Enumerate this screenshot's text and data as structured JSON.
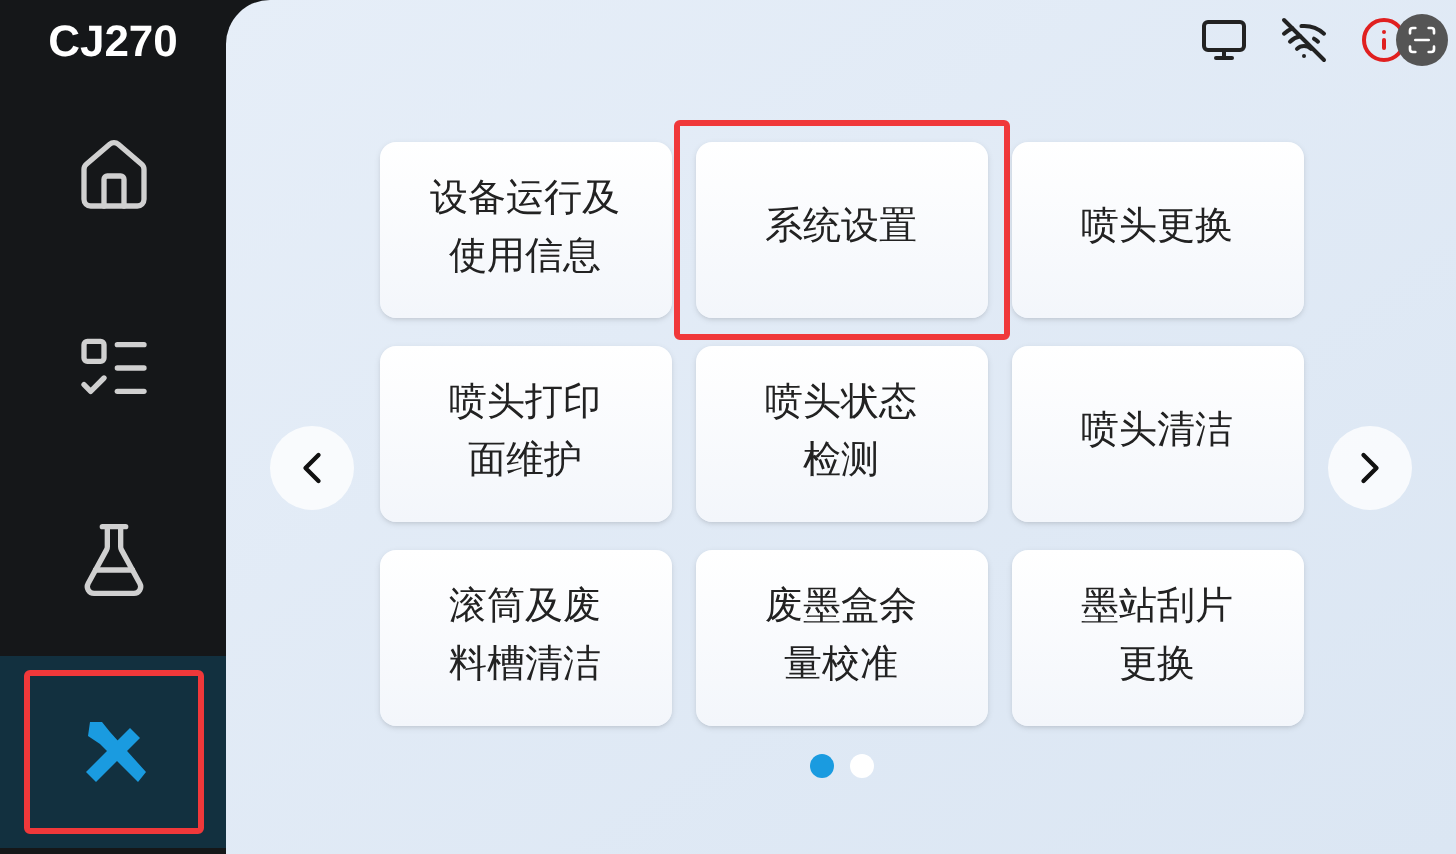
{
  "brand": "CJ270",
  "nav": [
    {
      "kind": "home",
      "selected": false,
      "highlighted": false
    },
    {
      "kind": "list",
      "selected": false,
      "highlighted": false
    },
    {
      "kind": "flask",
      "selected": false,
      "highlighted": false
    },
    {
      "kind": "tools",
      "selected": true,
      "highlighted": true
    }
  ],
  "tiles": [
    {
      "lines": [
        "设备运行及",
        "使用信息"
      ],
      "highlighted": false
    },
    {
      "lines": [
        "系统设置"
      ],
      "highlighted": true
    },
    {
      "lines": [
        "喷头更换"
      ],
      "highlighted": false
    },
    {
      "lines": [
        "喷头打印",
        "面维护"
      ],
      "highlighted": false
    },
    {
      "lines": [
        "喷头状态",
        "检测"
      ],
      "highlighted": false
    },
    {
      "lines": [
        "喷头清洁"
      ],
      "highlighted": false
    },
    {
      "lines": [
        "滚筒及废",
        "料槽清洁"
      ],
      "highlighted": false
    },
    {
      "lines": [
        "废墨盒余",
        "量校准"
      ],
      "highlighted": false
    },
    {
      "lines": [
        "墨站刮片",
        "更换"
      ],
      "highlighted": false
    }
  ],
  "pages": [
    {
      "selected": true
    },
    {
      "selected": false
    }
  ]
}
